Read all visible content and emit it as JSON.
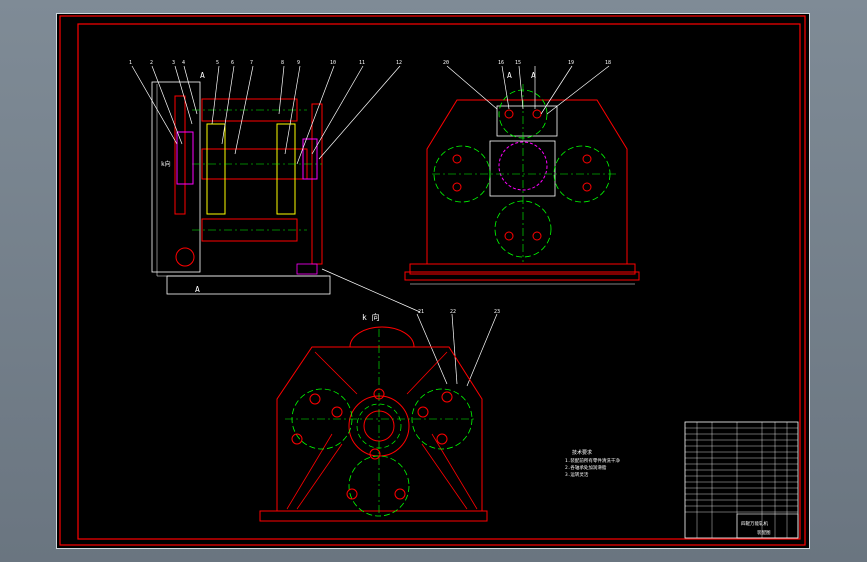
{
  "drawing": {
    "view_labels": {
      "section_a_top": "A",
      "section_a_bottom": "A",
      "section_a_pair_1": "A",
      "section_a_pair_2": "A",
      "k_view_side": "k向",
      "k_view_bottom": "k 向"
    },
    "callouts_side": [
      "1",
      "2",
      "3",
      "4",
      "5",
      "6",
      "7",
      "8",
      "9",
      "10",
      "11",
      "12"
    ],
    "callouts_front": [
      "20",
      "16",
      "15",
      "19",
      "18"
    ],
    "callouts_bottom": [
      "21",
      "22",
      "23"
    ],
    "notes": {
      "title": "技术要求",
      "line1": "1.装配前所有零件清洗干净",
      "line2": "2.各轴承处加润滑脂",
      "line3": "3.运转灵活"
    },
    "title_block": {
      "drawing_name": "四辊万能轧机",
      "sheet": "装配图"
    },
    "colors": {
      "frame": "#ff0000",
      "center_line": "#00ff00",
      "part": "#ffff00",
      "dim": "#ffffff",
      "hatch": "#ff00ff"
    }
  }
}
